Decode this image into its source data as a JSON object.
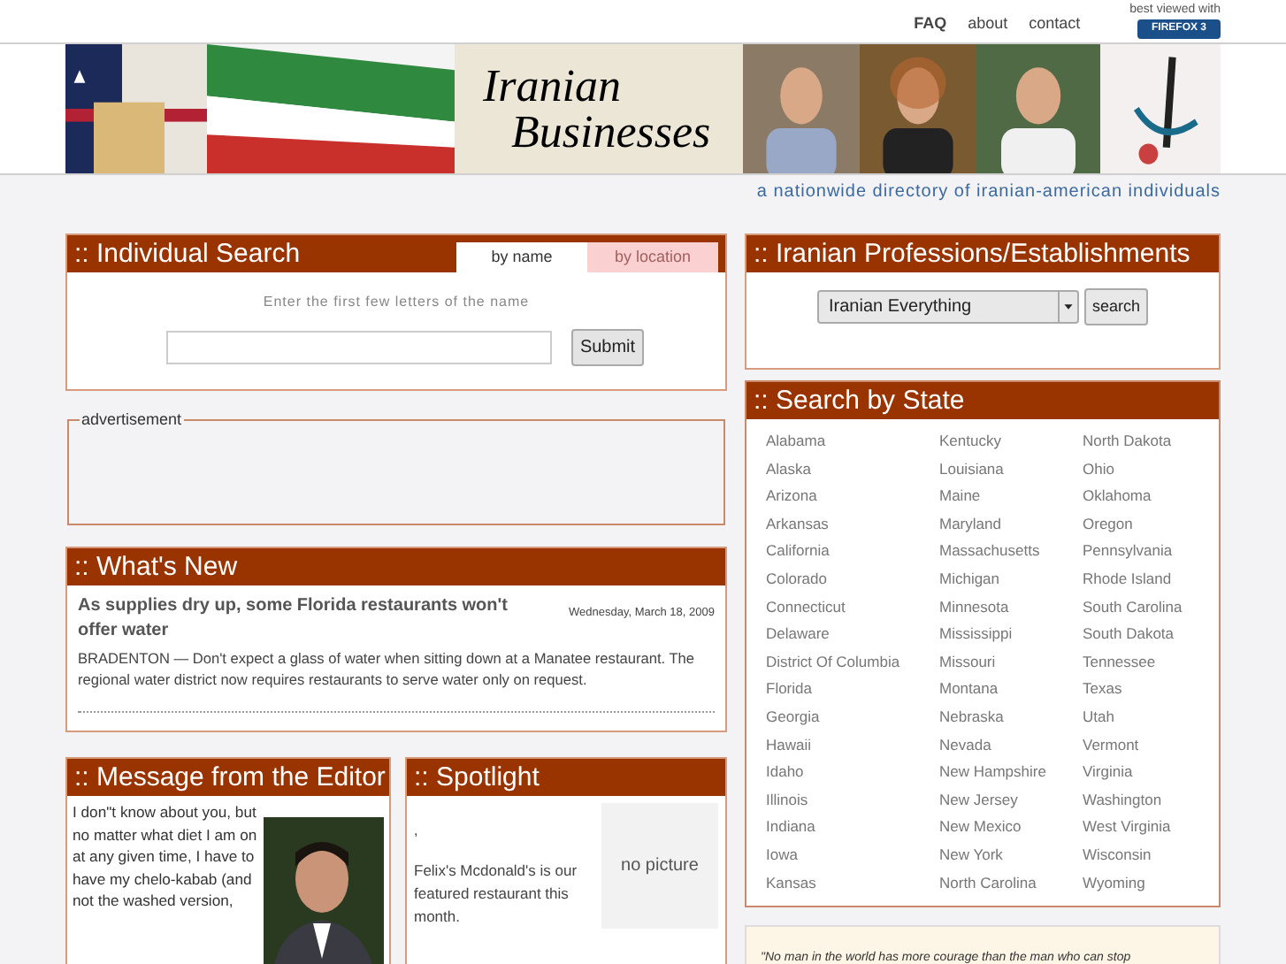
{
  "top_nav": {
    "links": [
      "FAQ",
      "about",
      "contact"
    ],
    "best_viewed": "best viewed with",
    "badge": "FIREFOX 3"
  },
  "banner": {
    "logo": [
      "Iranian",
      "Businesses"
    ],
    "tagline": "a nationwide directory of iranian-american individuals"
  },
  "individual_search": {
    "title": ":: Individual Search",
    "tabs": [
      {
        "label": "by name",
        "selected": true
      },
      {
        "label": "by location",
        "selected": false
      }
    ],
    "hint": "Enter the first few letters of the name",
    "button": "Submit"
  },
  "advertisement": {
    "legend": "advertisement"
  },
  "whats_new": {
    "title": ":: What's New",
    "headline": "As supplies dry up, some Florida restaurants won't offer water",
    "date": "Wednesday, March 18, 2009",
    "body": "BRADENTON — Don't expect a glass of water when sitting down at a Manatee restaurant. The regional water district now requires restaurants to serve water only on request."
  },
  "editor": {
    "title": ":: Message from the Editor",
    "text": "I don\"t know about you, but no matter what diet I am on at any given time, I have to have my chelo-kabab (and not the washed version,"
  },
  "spotlight": {
    "title": ":: Spotlight",
    "mark": ",",
    "text": "Felix's Mcdonald's is our featured restaurant this month.",
    "image_label": "no picture"
  },
  "professions": {
    "title": ":: Iranian Professions/Establishments",
    "select": "Iranian Everything",
    "button": "search"
  },
  "states": {
    "title": ":: Search by State",
    "columns": [
      [
        "Alabama",
        "Alaska",
        "Arizona",
        "Arkansas",
        "California",
        "Colorado",
        "Connecticut",
        "Delaware",
        "District Of Columbia",
        "Florida",
        "Georgia",
        "Hawaii",
        "Idaho",
        "Illinois",
        "Indiana",
        "Iowa",
        "Kansas"
      ],
      [
        "Kentucky",
        "Louisiana",
        "Maine",
        "Maryland",
        "Massachusetts",
        "Michigan",
        "Minnesota",
        "Mississippi",
        "Missouri",
        "Montana",
        "Nebraska",
        "Nevada",
        "New Hampshire",
        "New Jersey",
        "New Mexico",
        "New York",
        "North Carolina"
      ],
      [
        "North Dakota",
        "Ohio",
        "Oklahoma",
        "Oregon",
        "Pennsylvania",
        "Rhode Island",
        "South Carolina",
        "South Dakota",
        "Tennessee",
        "Texas",
        "Utah",
        "Vermont",
        "Virginia",
        "Washington",
        "West Virginia",
        "Wisconsin",
        "Wyoming"
      ]
    ]
  },
  "quote": {
    "text": "\"No man in the world has more courage than the man who can stop"
  }
}
